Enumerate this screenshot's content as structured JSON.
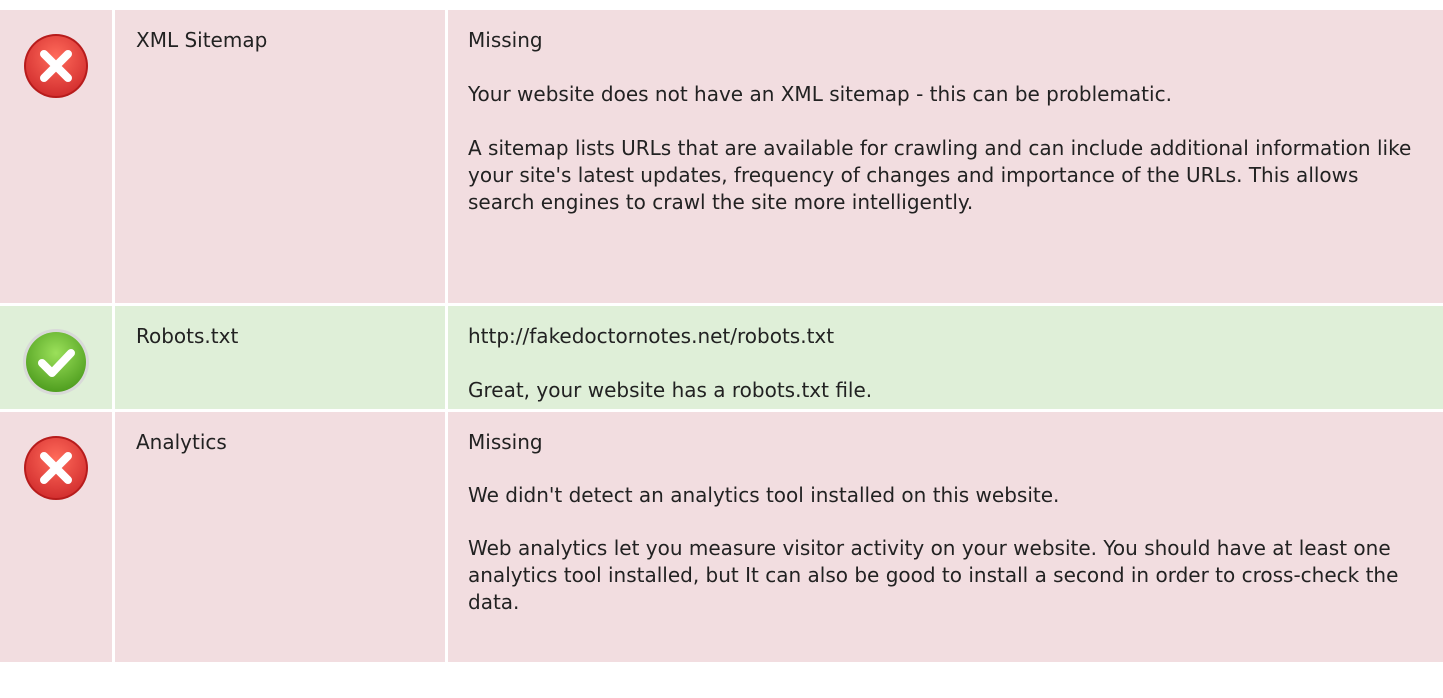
{
  "rows": [
    {
      "status": "error",
      "icon": "error-x-icon",
      "label": "XML Sitemap",
      "value": "Missing",
      "paragraphs": [
        "Your website does not have an XML sitemap - this can be problematic.",
        "A sitemap lists URLs that are available for crawling and can include additional information like your site's latest updates, frequency of changes and importance of the URLs. This allows search engines to crawl the site more intelligently."
      ]
    },
    {
      "status": "ok",
      "icon": "success-check-icon",
      "label": "Robots.txt",
      "value": "http://fakedoctornotes.net/robots.txt",
      "paragraphs": [
        "Great, your website has a robots.txt file."
      ]
    },
    {
      "status": "error",
      "icon": "error-x-icon",
      "label": "Analytics",
      "value": "Missing",
      "paragraphs": [
        "We didn't detect an analytics tool installed on this website.",
        "Web analytics let you measure visitor activity on your website. You should have at least one analytics tool installed, but It can also be good to install a second in order to cross-check the data."
      ]
    }
  ],
  "colors": {
    "error_bg": "#f2dde0",
    "ok_bg": "#dfefd8",
    "error_icon": "#e53935",
    "ok_icon": "#6cbf2c",
    "text": "#222222"
  }
}
